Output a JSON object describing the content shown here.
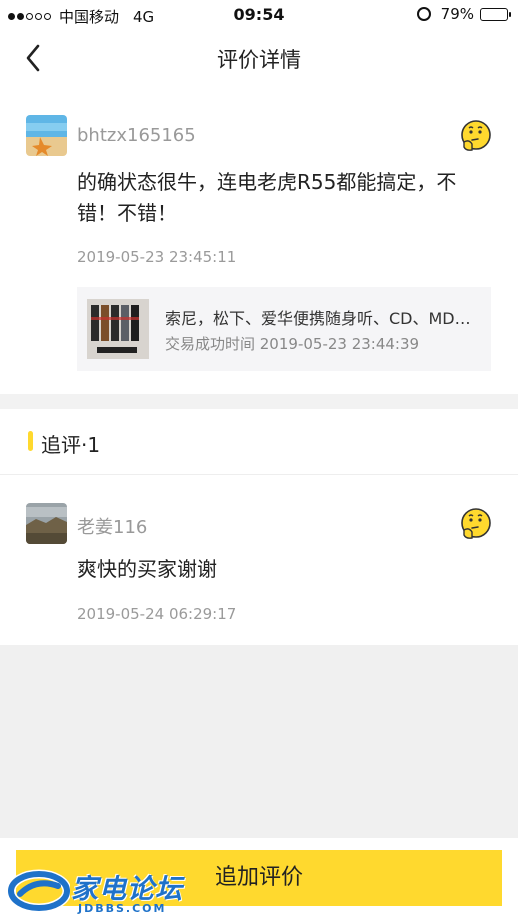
{
  "status_bar": {
    "carrier": "中国移动",
    "network": "4G",
    "time": "09:54",
    "battery": "79%",
    "battery_level": 0.79
  },
  "header": {
    "title": "评价详情"
  },
  "review": {
    "username": "bhtzx165165",
    "content": "的确状态很牛，连电老虎R55都能搞定，不错！不错！",
    "time": "2019-05-23 23:45:11",
    "like_icon": "thinking-face-icon",
    "product": {
      "name": "索尼，松下、爱华便携随身听、CD、MD…",
      "deal_time": "交易成功时间 2019-05-23 23:44:39"
    }
  },
  "followup": {
    "section_title": "追评·1",
    "username": "老姜116",
    "content": "爽快的买家谢谢",
    "time": "2019-05-24 06:29:17",
    "like_icon": "thinking-face-icon"
  },
  "footer": {
    "button_label": "追加评价"
  },
  "watermark": {
    "name": "家电论坛",
    "domain": "JDBBS.COM"
  },
  "colors": {
    "accent": "#ffd92e",
    "text": "#222222",
    "muted": "#999999",
    "watermark": "#1f72c9"
  }
}
